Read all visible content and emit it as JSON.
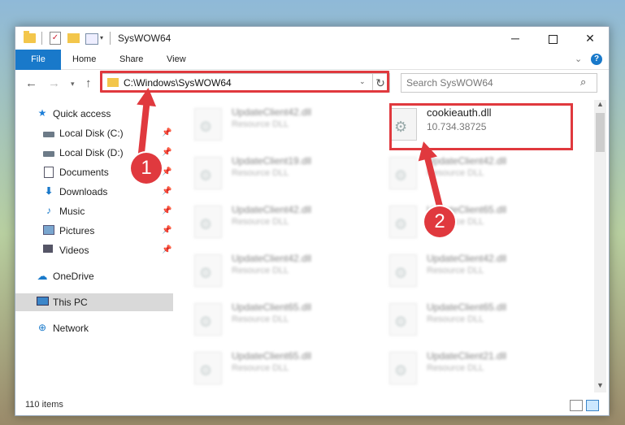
{
  "window": {
    "title": "SysWOW64",
    "controls": {
      "minimize": "─",
      "maximize": "",
      "close": "✕"
    }
  },
  "ribbon": {
    "tabs": [
      "File",
      "Home",
      "Share",
      "View"
    ],
    "help": "?"
  },
  "navbar": {
    "address": "C:\\Windows\\SysWOW64",
    "search_placeholder": "Search SysWOW64"
  },
  "sidebar": {
    "items": [
      {
        "label": "Quick access",
        "icon": "star-icon"
      },
      {
        "label": "Local Disk (C:)",
        "icon": "disk-icon",
        "pinned": true
      },
      {
        "label": "Local Disk (D:)",
        "icon": "disk-icon",
        "pinned": true
      },
      {
        "label": "Documents",
        "icon": "document-icon",
        "pinned": true
      },
      {
        "label": "Downloads",
        "icon": "download-icon",
        "pinned": true
      },
      {
        "label": "Music",
        "icon": "music-icon",
        "pinned": true
      },
      {
        "label": "Pictures",
        "icon": "picture-icon",
        "pinned": true
      },
      {
        "label": "Videos",
        "icon": "video-icon",
        "pinned": true
      },
      {
        "label": "OneDrive",
        "icon": "cloud-icon"
      },
      {
        "label": "This PC",
        "icon": "computer-icon"
      },
      {
        "label": "Network",
        "icon": "network-icon"
      }
    ]
  },
  "files": {
    "left": [
      {
        "name": "UpdateClient42.dll",
        "type": "Resource DLL"
      },
      {
        "name": "UpdateClient19.dll",
        "type": "Resource DLL"
      },
      {
        "name": "UpdateClient42.dll",
        "type": "Resource DLL"
      },
      {
        "name": "UpdateClient42.dll",
        "type": "Resource DLL"
      },
      {
        "name": "UpdateClient65.dll",
        "type": "Resource DLL"
      },
      {
        "name": "UpdateClient65.dll",
        "type": "Resource DLL"
      }
    ],
    "right": [
      {
        "name": "cookieauth.dll",
        "type": "10.734.38725"
      },
      {
        "name": "UpdateClient42.dll",
        "type": "Resource DLL"
      },
      {
        "name": "UpdateClient65.dll",
        "type": "Resource DLL"
      },
      {
        "name": "UpdateClient42.dll",
        "type": "Resource DLL"
      },
      {
        "name": "UpdateClient65.dll",
        "type": "Resource DLL"
      },
      {
        "name": "UpdateClient21.dll",
        "type": "Resource DLL"
      }
    ]
  },
  "status": {
    "item_count": "110 items"
  },
  "annotations": {
    "step1": "1",
    "step2": "2",
    "color": "#e0393e"
  }
}
